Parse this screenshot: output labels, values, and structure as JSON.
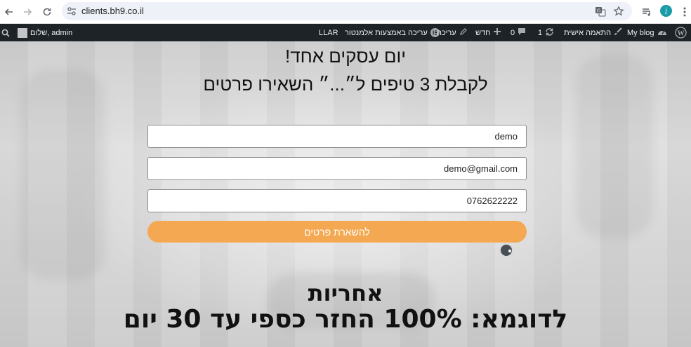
{
  "browser": {
    "url": "clients.bh9.co.il",
    "avatar_letter": "j"
  },
  "adminbar": {
    "greeting": "שלום, admin",
    "my_blog": "My blog",
    "customize": "התאמה אישית",
    "updates_count": "1",
    "comments_count": "0",
    "new": "חדש",
    "edit": "עריכה",
    "edit_elementor": "עריכה באמצעות אלמנטור",
    "llar": "LLAR"
  },
  "hero": {
    "title_line1": "יום עסקים אחד!",
    "title_line2": "לקבלת 3 טיפים ל״...״ השאירו פרטים",
    "form": {
      "name_value": "demo",
      "email_value": "demo@gmail.com",
      "phone_value": "0762622222",
      "submit_label": "להשארת פרטים"
    },
    "guarantee_heading": "אחריות",
    "guarantee_text": "לדוגמא: 100% החזר כספי עד 30 יום"
  },
  "colors": {
    "adminbar_bg": "#1d2327",
    "submit_bg": "#f5a852",
    "avatar_bg": "#1a9ba8"
  }
}
